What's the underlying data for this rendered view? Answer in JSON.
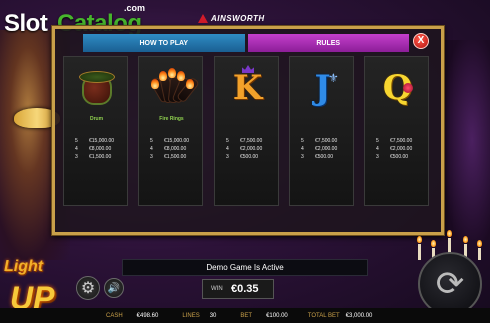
{
  "watermark": {
    "slot": "Slot",
    "catalog": "Catalog",
    "com": ".com"
  },
  "brand": {
    "name": "AINSWORTH"
  },
  "paytable": {
    "tabs": {
      "how_to_play": "HOW TO PLAY",
      "rules": "RULES"
    },
    "close_label": "X",
    "cards": [
      {
        "symbol": "drum",
        "name": "Drum",
        "pays": [
          {
            "n": "5",
            "v": "€15,000.00"
          },
          {
            "n": "4",
            "v": "€8,000.00"
          },
          {
            "n": "3",
            "v": "€1,500.00"
          }
        ]
      },
      {
        "symbol": "fire-rings",
        "name": "Fire Rings",
        "pays": [
          {
            "n": "5",
            "v": "€15,000.00"
          },
          {
            "n": "4",
            "v": "€8,000.00"
          },
          {
            "n": "3",
            "v": "€1,500.00"
          }
        ]
      },
      {
        "symbol": "K",
        "name": "",
        "pays": [
          {
            "n": "5",
            "v": "€7,500.00"
          },
          {
            "n": "4",
            "v": "€2,000.00"
          },
          {
            "n": "3",
            "v": "€500.00"
          }
        ]
      },
      {
        "symbol": "J",
        "name": "",
        "pays": [
          {
            "n": "5",
            "v": "€7,500.00"
          },
          {
            "n": "4",
            "v": "€2,000.00"
          },
          {
            "n": "3",
            "v": "€500.00"
          }
        ]
      },
      {
        "symbol": "Q",
        "name": "",
        "pays": [
          {
            "n": "5",
            "v": "€7,500.00"
          },
          {
            "n": "4",
            "v": "€2,000.00"
          },
          {
            "n": "3",
            "v": "€500.00"
          }
        ]
      }
    ]
  },
  "demo_message": "Demo Game Is Active",
  "win": {
    "label": "WIN",
    "value": "€0.35"
  },
  "game_logo": {
    "line1": "Light",
    "line2": "UP"
  },
  "status": {
    "cash_label": "CASH",
    "cash_value": "€498.60",
    "lines_label": "LINES",
    "lines_value": "30",
    "bet_label": "BET",
    "bet_value": "€100.00",
    "total_bet_label": "TOTAL BET",
    "total_bet_value": "€3,000.00"
  }
}
